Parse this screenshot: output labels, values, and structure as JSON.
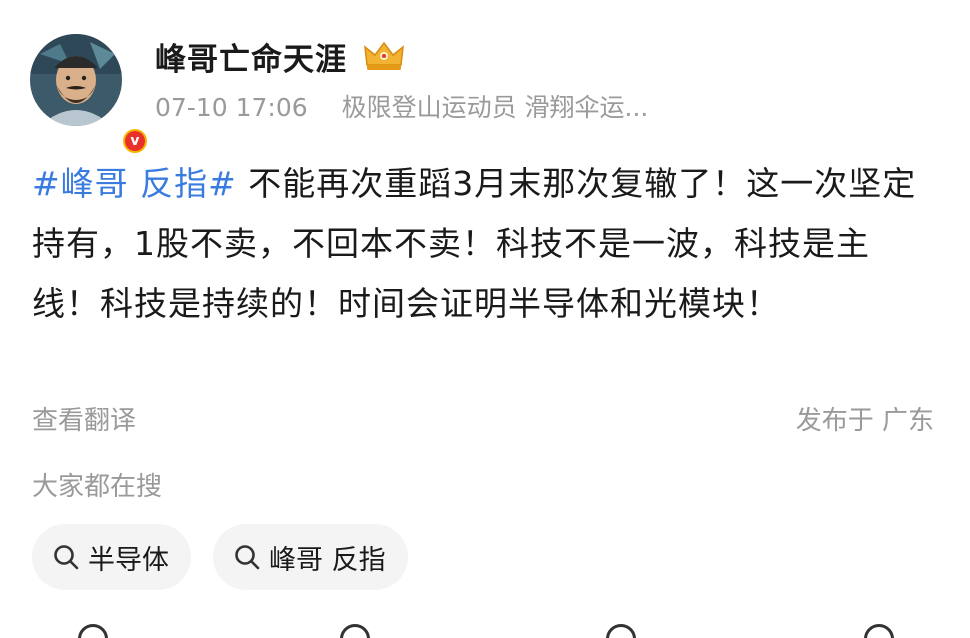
{
  "post": {
    "author": {
      "name": "峰哥亡命天涯",
      "avatar_icon": "bearded-man-avatar",
      "verified_icon": "verified-v-badge",
      "verified_glyph": "v",
      "member_icon": "crown-icon"
    },
    "meta": {
      "time": "07-10 17:06",
      "bio": "极限登山运动员 滑翔伞运..."
    },
    "content": {
      "hashtag": "#峰哥 反指#",
      "text": " 不能再次重蹈3月末那次复辙了！这一次坚定持有，1股不卖，不回本不卖！科技不是一波，科技是主线！科技是持续的！时间会证明半导体和光模块！"
    },
    "translate_label": "查看翻译",
    "location_label": "发布于 广东"
  },
  "related_search": {
    "title": "大家都在搜",
    "chips": [
      {
        "label": "半导体",
        "icon": "search-icon"
      },
      {
        "label": "峰哥 反指",
        "icon": "search-icon"
      }
    ]
  },
  "colors": {
    "hashtag": "#3a7be0",
    "secondary_text": "#9a9a9a",
    "chip_bg": "#f4f4f4",
    "badge_gold": "#f7b500",
    "badge_red": "#e8312b"
  }
}
